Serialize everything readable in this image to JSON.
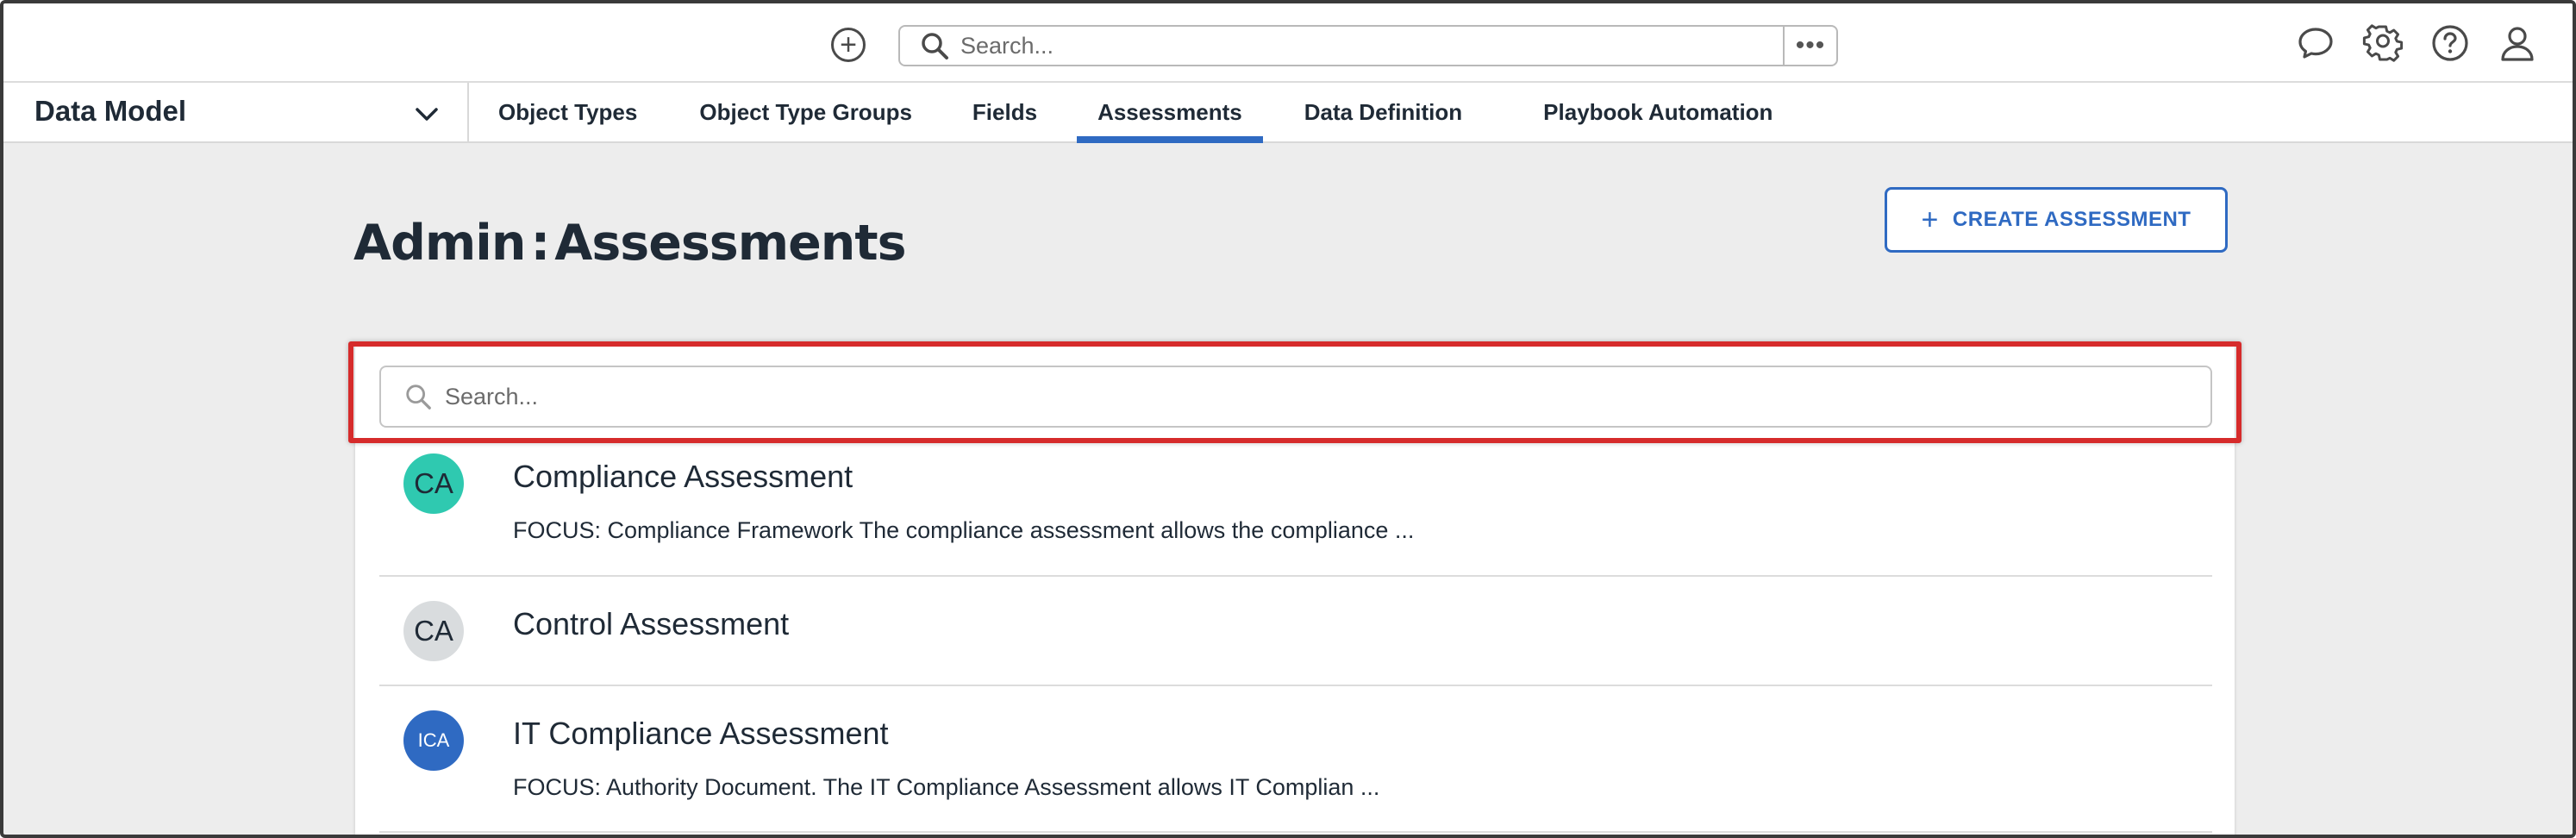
{
  "topbar": {
    "search_placeholder": "Search...",
    "more_label": "•••",
    "icons": [
      "add-icon",
      "search-icon",
      "chat-icon",
      "gear-icon",
      "help-icon",
      "user-icon"
    ]
  },
  "nav": {
    "module_label": "Data Model",
    "tabs": [
      {
        "label": "Object Types"
      },
      {
        "label": "Object Type Groups"
      },
      {
        "label": "Fields"
      },
      {
        "label": "Assessments",
        "active": true
      },
      {
        "label": "Data Definition"
      },
      {
        "label": "Playbook Automation"
      }
    ]
  },
  "main": {
    "title_prefix": "Admin",
    "title_separator": ":",
    "title": "Assessments",
    "create_button": {
      "icon": "+",
      "label": "CREATE ASSESSMENT"
    },
    "search_placeholder": "Search..."
  },
  "assessments": [
    {
      "initials": "CA",
      "avatar_color": "#2fc9b0",
      "name": "Compliance Assessment",
      "description": "FOCUS: Compliance Framework The compliance assessment allows the compliance ..."
    },
    {
      "initials": "CA",
      "avatar_color": "#d9dcde",
      "name": "Control Assessment",
      "description": ""
    },
    {
      "initials": "ICA",
      "avatar_color": "#2f6ac2",
      "name": "IT Compliance Assessment",
      "description": "FOCUS: Authority Document. The IT Compliance Assessment allows IT Complian ..."
    }
  ],
  "colors": {
    "accent": "#2f6ac2",
    "highlight": "#d62b2b",
    "text": "#1f2a36",
    "background": "#ededed"
  }
}
